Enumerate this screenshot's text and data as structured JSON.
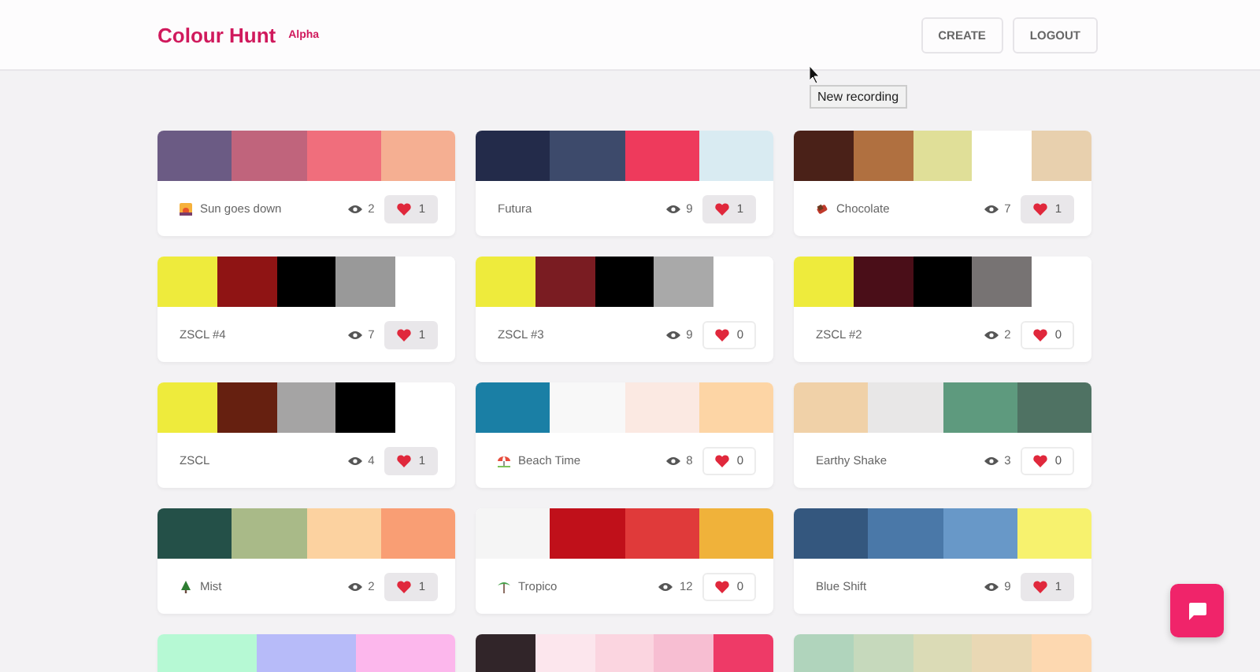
{
  "header": {
    "logo": "Colour Hunt",
    "badge": "Alpha",
    "buttons": [
      "CREATE",
      "LOGOUT"
    ]
  },
  "tooltip": "New recording",
  "palettes": [
    {
      "name": "Sun goes down",
      "views": "2",
      "likes": "1",
      "liked": true,
      "swatches": [
        {
          "color": "#6b5b84"
        },
        {
          "color": "#c0647c"
        },
        {
          "color": "#f06e7c"
        },
        {
          "color": "#f5af92"
        }
      ]
    },
    {
      "name": "Futura",
      "views": "9",
      "likes": "1",
      "liked": true,
      "swatches": [
        {
          "color": "#232b4a"
        },
        {
          "color": "#3d4a6b"
        },
        {
          "color": "#ee3a5c"
        },
        {
          "color": "#d9ebf2"
        }
      ]
    },
    {
      "name": "Chocolate",
      "views": "7",
      "likes": "1",
      "liked": true,
      "swatches": [
        {
          "color": "#4a2118"
        },
        {
          "color": "#b07040"
        },
        {
          "color": "#e0df98"
        },
        {
          "color": "#ffffff"
        },
        {
          "color": "#e8d0ae"
        }
      ]
    },
    {
      "name": "ZSCL #4",
      "views": "7",
      "likes": "1",
      "liked": true,
      "swatches": [
        {
          "color": "#eeeb3c"
        },
        {
          "color": "#8f1414"
        },
        {
          "color": "#000000"
        },
        {
          "color": "#999999"
        },
        {
          "color": "#ffffff"
        }
      ]
    },
    {
      "name": "ZSCL #3",
      "views": "9",
      "likes": "0",
      "liked": false,
      "swatches": [
        {
          "color": "#eeeb3c"
        },
        {
          "color": "#7a1c22"
        },
        {
          "color": "#000000"
        },
        {
          "color": "#a9a9a9"
        },
        {
          "color": "#ffffff"
        }
      ]
    },
    {
      "name": "ZSCL #2",
      "views": "2",
      "likes": "0",
      "liked": false,
      "swatches": [
        {
          "color": "#eeeb3c"
        },
        {
          "color": "#4a0e18"
        },
        {
          "color": "#000000"
        },
        {
          "color": "#777373"
        },
        {
          "color": "#ffffff"
        }
      ]
    },
    {
      "name": "ZSCL",
      "views": "4",
      "likes": "1",
      "liked": true,
      "swatches": [
        {
          "color": "#eeeb3c"
        },
        {
          "color": "#662010"
        },
        {
          "color": "#a5a4a4"
        },
        {
          "color": "#000000"
        },
        {
          "color": "#ffffff"
        }
      ]
    },
    {
      "name": "Beach Time",
      "views": "8",
      "likes": "0",
      "liked": false,
      "swatches": [
        {
          "color": "#1a7fa5"
        },
        {
          "color": "#f8f8f8"
        },
        {
          "color": "#fbe9e2"
        },
        {
          "color": "#fdd5a5"
        }
      ]
    },
    {
      "name": "Earthy Shake",
      "views": "3",
      "likes": "0",
      "liked": false,
      "swatches": [
        {
          "color": "#f0d1a8"
        },
        {
          "color": "#e8e7e7"
        },
        {
          "color": "#5e9a7e"
        },
        {
          "color": "#4f7263"
        }
      ]
    },
    {
      "name": "Mist",
      "views": "2",
      "likes": "1",
      "liked": true,
      "swatches": [
        {
          "color": "#245048"
        },
        {
          "color": "#a9ba88"
        },
        {
          "color": "#fcd2a0"
        },
        {
          "color": "#f99e74"
        }
      ]
    },
    {
      "name": "Tropico",
      "views": "12",
      "likes": "0",
      "liked": false,
      "swatches": [
        {
          "color": "#f5f5f5"
        },
        {
          "color": "#c0101a"
        },
        {
          "color": "#e03a3a"
        },
        {
          "color": "#f0b23a"
        }
      ]
    },
    {
      "name": "Blue Shift",
      "views": "9",
      "likes": "1",
      "liked": true,
      "swatches": [
        {
          "color": "#34577e"
        },
        {
          "color": "#4a78a8"
        },
        {
          "color": "#6898c8"
        },
        {
          "color": "#f7f26e"
        }
      ]
    },
    {
      "swatches": [
        {
          "color": "#b6f9d4"
        },
        {
          "color": "#b7bbf9"
        },
        {
          "color": "#fcb7ec"
        }
      ]
    },
    {
      "swatches": [
        {
          "color": "#312529"
        },
        {
          "color": "#fce6ed"
        },
        {
          "color": "#fbd5e0"
        },
        {
          "color": "#f7bed2"
        },
        {
          "color": "#ee3a67"
        }
      ]
    },
    {
      "swatches": [
        {
          "color": "#b0d4bc"
        },
        {
          "color": "#c6d9bc"
        },
        {
          "color": "#dbdbb6"
        },
        {
          "color": "#e9d8b4"
        },
        {
          "color": "#fdd8b0"
        }
      ]
    }
  ]
}
